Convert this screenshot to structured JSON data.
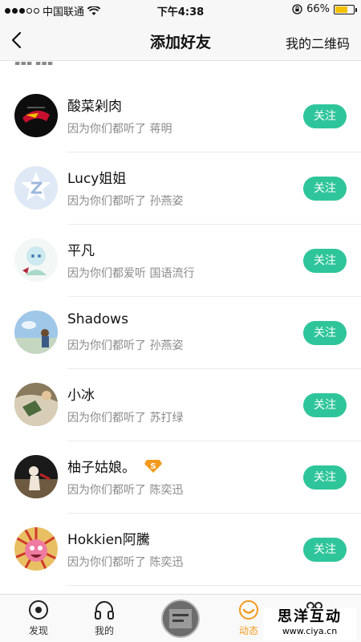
{
  "status_bar": {
    "carrier": "中国联通",
    "time": "下午4:38",
    "battery": "66%",
    "battery_level": 0.66
  },
  "nav": {
    "title": "添加好友",
    "right_action": "我的二维码"
  },
  "follow_label": "关注",
  "users": [
    {
      "name": "酸菜剁肉",
      "reason": "因为你们都听了 蒋明",
      "avatar": "cars-logo-avatar"
    },
    {
      "name": "Lucy姐姐",
      "reason": "因为你们都听了 孙燕姿",
      "avatar": "default-q-avatar"
    },
    {
      "name": "平凡",
      "reason": "因为你们都爱听 国语流行",
      "avatar": "anime-avatar"
    },
    {
      "name": "Shadows",
      "reason": "因为你们都听了 孙燕姿",
      "avatar": "sky-avatar"
    },
    {
      "name": "小冰",
      "reason": "因为你们都听了 苏打绿",
      "avatar": "photo-avatar"
    },
    {
      "name": "柚子姑娘。",
      "reason": "因为你们都听了 陈奕迅",
      "avatar": "silhouette-avatar",
      "badge": "S"
    },
    {
      "name": "Hokkien阿騰",
      "reason": "因为你们都听了 陈奕迅",
      "avatar": "pink-face-avatar"
    }
  ],
  "tabs": [
    {
      "label": "发现",
      "icon": "discover-icon"
    },
    {
      "label": "我的",
      "icon": "headphones-icon"
    },
    {
      "label": "动态",
      "icon": "activity-icon",
      "active": true
    },
    {
      "label": "",
      "icon": "friends-icon"
    }
  ],
  "watermark": {
    "title": "思洋互动",
    "url": "www.ciya.cn"
  },
  "colors": {
    "accent": "#2fc59b",
    "active_tab": "#f39a1d",
    "secondary_text": "#8a8a8a"
  }
}
